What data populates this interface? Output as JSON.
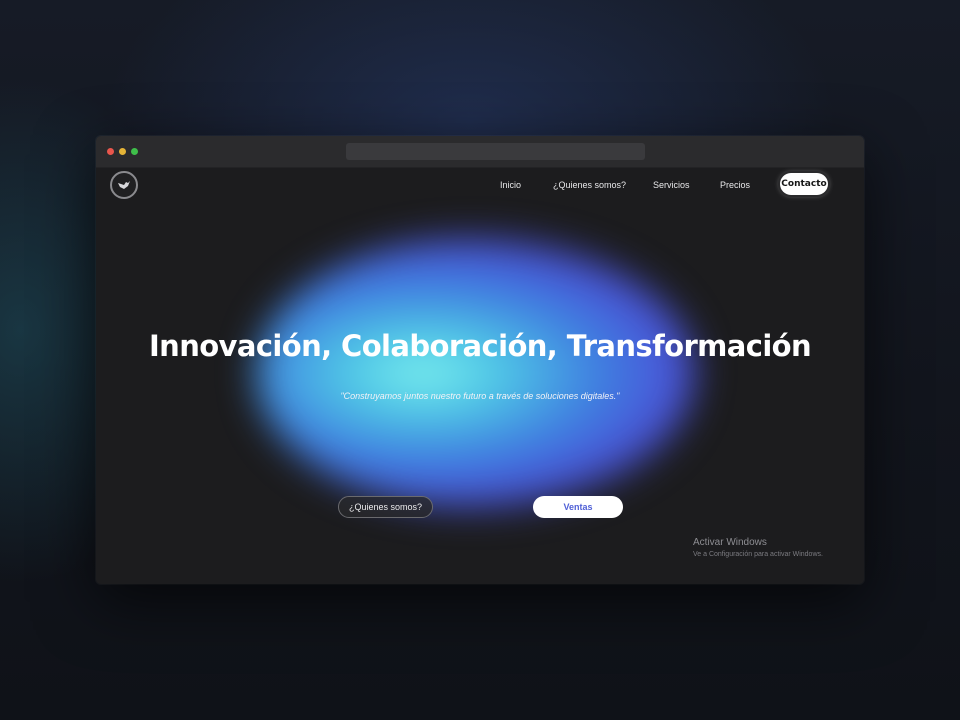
{
  "window": {
    "controls": [
      "close",
      "minimize",
      "maximize"
    ]
  },
  "nav": {
    "logo_icon": "whale-icon",
    "items": [
      {
        "label": "Inicio"
      },
      {
        "label": "¿Quienes somos?"
      },
      {
        "label": "Servicios"
      },
      {
        "label": "Precios"
      }
    ],
    "contact_label": "Contacto"
  },
  "hero": {
    "title": "Innovación, Colaboración, Transformación",
    "subtitle": "\"Construyamos juntos nuestro futuro a través de soluciones digitales.\"",
    "secondary_button": "¿Quienes somos?",
    "primary_button": "Ventas"
  },
  "watermark": {
    "title": "Activar Windows",
    "subtitle": "Ve a Configuración para activar Windows."
  },
  "colors": {
    "background": "#12151d",
    "page": "#1c1c1e",
    "glow_cyan": "#7ef0ee",
    "glow_blue": "#4a54d8",
    "accent_text": "#4f5fd6",
    "close": "#e9564c",
    "minimize": "#e5b437",
    "maximize": "#3fbf4a"
  }
}
